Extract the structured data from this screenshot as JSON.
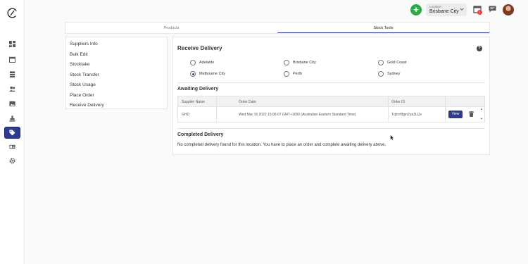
{
  "nav": {
    "items": [
      {
        "name": "dashboard-icon"
      },
      {
        "name": "calendar-icon"
      },
      {
        "name": "archive-icon"
      },
      {
        "name": "users-icon"
      },
      {
        "name": "image-icon"
      },
      {
        "name": "stamp-icon"
      },
      {
        "name": "tag-icon",
        "active": true
      },
      {
        "name": "id-card-icon"
      },
      {
        "name": "gear-icon"
      }
    ]
  },
  "topbar": {
    "location_label": "Location",
    "location_value": "Brisbane City",
    "notification_count": "1"
  },
  "tabs": [
    {
      "label": "Products",
      "active": false
    },
    {
      "label": "Stock Tools",
      "active": true
    }
  ],
  "menu": {
    "items": [
      "Suppliers Info",
      "Bulk Edit",
      "Stocktake",
      "Stock Transfer",
      "Stock Usage",
      "Place Order",
      "Receive Delivery"
    ]
  },
  "receive": {
    "title": "Receive Delivery",
    "locations": [
      {
        "label": "Adelaide",
        "selected": false
      },
      {
        "label": "Brisbane City",
        "selected": false
      },
      {
        "label": "Gold Coast",
        "selected": false
      },
      {
        "label": "Melbourne City",
        "selected": true
      },
      {
        "label": "Perth",
        "selected": false
      },
      {
        "label": "Sydney",
        "selected": false
      }
    ]
  },
  "awaiting": {
    "title": "Awaiting Delivery",
    "columns": [
      "Supplier Name",
      "Order Date",
      "Order ID"
    ],
    "rows": [
      {
        "supplier": "GHD",
        "date": "Wed Mar 16 2022 15:06:07 GMT+1000 (Australian Eastern Standard Time)",
        "order_id": "TqfcrrBjpn2ya3LQv",
        "view_label": "View"
      }
    ]
  },
  "completed": {
    "title": "Completed Delivery",
    "message": "No completed delivery found for this location. You have to place an order and complete awaiting delivery above."
  }
}
